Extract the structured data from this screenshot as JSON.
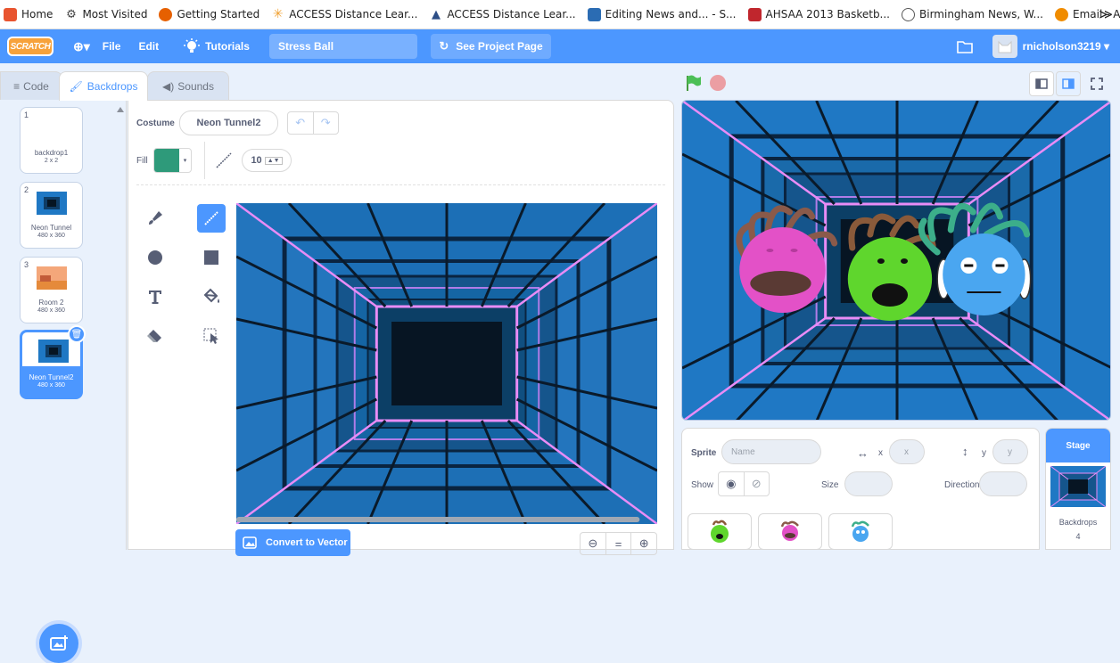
{
  "bookmarks": [
    {
      "label": "Home",
      "color": "#e8542f"
    },
    {
      "label": "Most Visited",
      "color": "#5a5a5a"
    },
    {
      "label": "Getting Started",
      "color": "#e66000"
    },
    {
      "label": "ACCESS Distance Lear...",
      "color": "#f0a030"
    },
    {
      "label": "ACCESS Distance Lear...",
      "color": "#2d4e86"
    },
    {
      "label": "Editing News and... - S...",
      "color": "#2b6cb3"
    },
    {
      "label": "AHSAA 2013 Basketb...",
      "color": "#c0262d"
    },
    {
      "label": "Birmingham News, W...",
      "color": "#555555"
    },
    {
      "label": "Email - ACCESS Distan...",
      "color": "#f08c00"
    }
  ],
  "bookmarks_overflow": "≫",
  "menubar": {
    "logo": "SCRATCH",
    "globe": "⊕▾",
    "file": "File",
    "edit": "Edit",
    "tutorials": "Tutorials",
    "project_title": "Stress Ball",
    "see_project": "See Project Page",
    "username": "rnicholson3219 ▾"
  },
  "tabs": {
    "code": "Code",
    "backdrops": "Backdrops",
    "sounds": "Sounds"
  },
  "backdrops": [
    {
      "num": "1",
      "name": "backdrop1",
      "size": "2 x 2"
    },
    {
      "num": "2",
      "name": "Neon Tunnel",
      "size": "480 x 360"
    },
    {
      "num": "3",
      "name": "Room 2",
      "size": "480 x 360"
    },
    {
      "num": "4",
      "name": "Neon Tunnel2",
      "size": "480 x 360"
    }
  ],
  "editor": {
    "costume_label": "Costume",
    "costume_name": "Neon Tunnel2",
    "fill_label": "Fill",
    "fill_color": "#2e9a7a",
    "stroke_width": "10",
    "convert_button": "Convert to Vector",
    "zoom_out": "⊖",
    "zoom_reset": "=",
    "zoom_in": "⊕"
  },
  "sprite_info": {
    "sprite_label": "Sprite",
    "name_placeholder": "Name",
    "x_label": "x",
    "x_placeholder": "x",
    "y_label": "y",
    "y_placeholder": "y",
    "show_label": "Show",
    "size_label": "Size",
    "direction_label": "Direction"
  },
  "stage_pane": {
    "title": "Stage",
    "backdrops_label": "Backdrops",
    "backdrops_count": "4"
  },
  "colors": {
    "accent": "#4c97ff",
    "tunnel_dark": "#0a1a2a",
    "tunnel_blue": "#1f78c4",
    "neon_pink": "#e57cf2"
  }
}
